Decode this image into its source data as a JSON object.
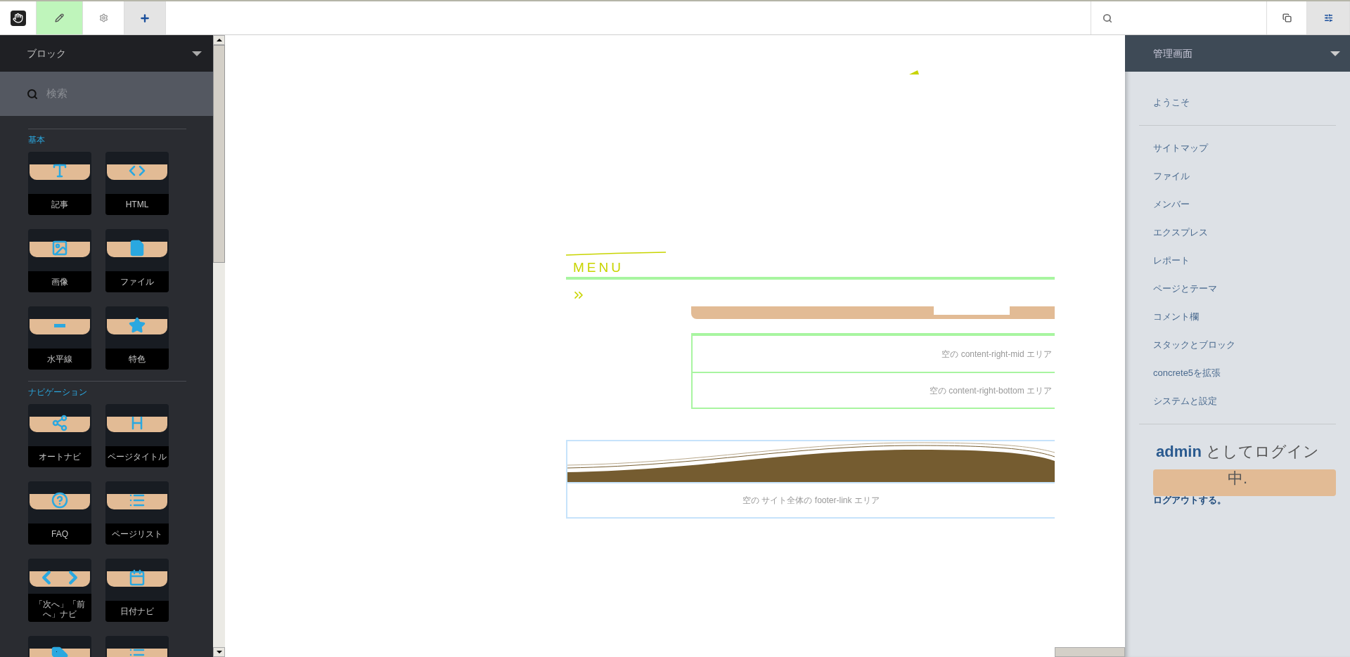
{
  "toolbar": {
    "left": [
      {
        "kind": "logo",
        "selected": false
      },
      {
        "kind": "edit",
        "selected": true
      },
      {
        "kind": "settings",
        "selected": false
      },
      {
        "kind": "add",
        "selected": true
      }
    ],
    "right": [
      {
        "kind": "pages",
        "selected": false
      },
      {
        "kind": "dashboard",
        "selected": true
      }
    ]
  },
  "block_panel": {
    "title": "ブロック",
    "search": {
      "placeholder": "検索"
    },
    "sections": [
      {
        "title": "基本",
        "items": [
          {
            "kind": "text",
            "label": "記事"
          },
          {
            "kind": "code",
            "label": "HTML"
          },
          {
            "kind": "image",
            "label": "画像"
          },
          {
            "kind": "file",
            "label": "ファイル"
          },
          {
            "kind": "rule",
            "label": "水平線"
          },
          {
            "kind": "star",
            "label": "特色"
          }
        ]
      },
      {
        "title": "ナビゲーション",
        "items": [
          {
            "kind": "share",
            "label": "オートナビ"
          },
          {
            "kind": "heading",
            "label": "ページタイトル"
          },
          {
            "kind": "help",
            "label": "FAQ"
          },
          {
            "kind": "list",
            "label": "ページリスト"
          },
          {
            "kind": "arrows",
            "label": "「次へ」「前へ」ナビ"
          },
          {
            "kind": "calendar",
            "label": "日付ナビ"
          },
          {
            "kind": "tag"
          },
          {
            "kind": "list"
          }
        ]
      }
    ]
  },
  "page": {
    "heading": "MENU",
    "areas": [
      "空の content-right-mid エリア",
      "空の content-right-bottom エリア"
    ],
    "footer_area": "空の サイト全体の footer-link エリア"
  },
  "dashboard_panel": {
    "title": "管理画面",
    "groups": [
      [
        "ようこそ"
      ],
      [
        "サイトマップ",
        "ファイル",
        "メンバー",
        "エクスプレス",
        "レポート",
        "ページとテーマ",
        "コメント欄",
        "スタックとブロック",
        "concrete5を拡張",
        "システムと設定"
      ]
    ],
    "login": {
      "message": "**admin** としてログイン中.",
      "logout": "ログアウトする。"
    }
  }
}
